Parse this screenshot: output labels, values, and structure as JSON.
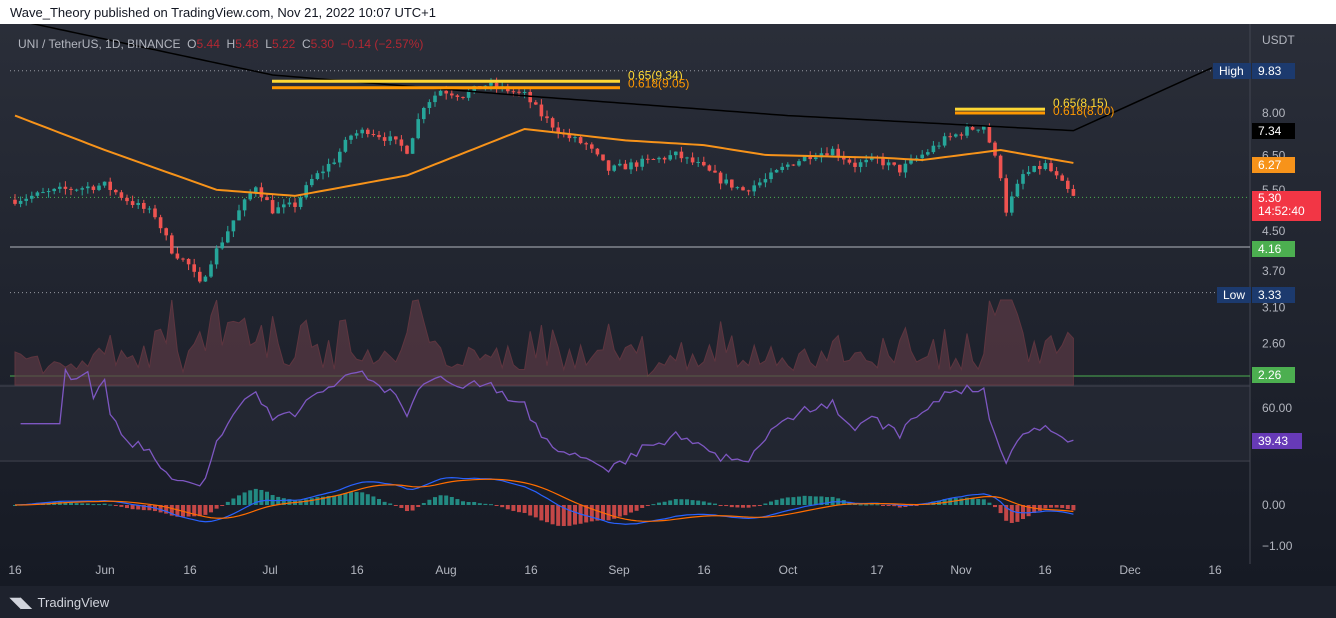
{
  "header": {
    "publisher": "Wave_Theory published on TradingView.com, Nov 21, 2022 10:07 UTC+1"
  },
  "legend": {
    "symbol": "UNI / TetherUS, 1D, BINANCE",
    "o_label": "O",
    "o": "5.44",
    "h_label": "H",
    "h": "5.48",
    "l_label": "L",
    "l": "5.22",
    "c_label": "C",
    "c": "5.30",
    "change": "−0.14 (−2.57%)"
  },
  "price_axis": {
    "currency": "USDT",
    "ticks": [
      "8.00",
      "6.50",
      "5.50",
      "4.50",
      "3.70",
      "3.10",
      "2.60"
    ]
  },
  "tags": {
    "high_label": "High",
    "high": "9.83",
    "ma200": "7.34",
    "ma50": "6.27",
    "last": "5.30",
    "countdown": "14:52:40",
    "support": "4.16",
    "low_label": "Low",
    "low": "3.33",
    "volume": "2.26",
    "rsi": "39.43"
  },
  "fib": {
    "a1": "0.65(9.34)",
    "a2": "0.618(9.05)",
    "b1": "0.65(8.15)",
    "b2": "0.618(8.00)"
  },
  "rsi_axis": {
    "ticks": [
      "60.00"
    ]
  },
  "macd_axis": {
    "ticks": [
      "0.00",
      "−1.00"
    ]
  },
  "time_axis": {
    "ticks": [
      "16",
      "Jun",
      "16",
      "Jul",
      "16",
      "Aug",
      "16",
      "Sep",
      "16",
      "Oct",
      "17",
      "Nov",
      "16",
      "Dec",
      "16"
    ]
  },
  "footer": {
    "brand": "TradingView"
  },
  "colors": {
    "up": "#26a69a",
    "down": "#ef5350",
    "ma50": "#f7931a",
    "ma200": "#000000",
    "rsi": "#7e57c2",
    "fib1": "#fdd835",
    "fib2": "#ff9800"
  },
  "chart_data": {
    "type": "candlestick",
    "title": "UNI / TetherUS, 1D, BINANCE",
    "scale": "log",
    "ylim": [
      2.3,
      11
    ],
    "close_anchors": [
      [
        "2022-05-16",
        5.24
      ],
      [
        "2022-05-24",
        5.49
      ],
      [
        "2022-06-01",
        5.63
      ],
      [
        "2022-06-05",
        5.24
      ],
      [
        "2022-06-10",
        4.86
      ],
      [
        "2022-06-13",
        4.1
      ],
      [
        "2022-06-16",
        3.81
      ],
      [
        "2022-06-18",
        3.46
      ],
      [
        "2022-06-20",
        3.9
      ],
      [
        "2022-06-24",
        4.74
      ],
      [
        "2022-06-28",
        5.63
      ],
      [
        "2022-07-01",
        4.98
      ],
      [
        "2022-07-05",
        5.11
      ],
      [
        "2022-07-08",
        5.77
      ],
      [
        "2022-07-12",
        6.36
      ],
      [
        "2022-07-15",
        7.18
      ],
      [
        "2022-07-18",
        7.36
      ],
      [
        "2022-07-22",
        7.02
      ],
      [
        "2022-07-25",
        6.68
      ],
      [
        "2022-07-28",
        8.32
      ],
      [
        "2022-07-31",
        8.95
      ],
      [
        "2022-08-04",
        8.73
      ],
      [
        "2022-08-08",
        9.17
      ],
      [
        "2022-08-12",
        8.95
      ],
      [
        "2022-08-15",
        8.73
      ],
      [
        "2022-08-18",
        7.92
      ],
      [
        "2022-08-22",
        7.18
      ],
      [
        "2022-08-26",
        6.84
      ],
      [
        "2022-08-30",
        6.06
      ],
      [
        "2022-09-03",
        6.21
      ],
      [
        "2022-09-07",
        6.36
      ],
      [
        "2022-09-11",
        6.52
      ],
      [
        "2022-09-15",
        6.21
      ],
      [
        "2022-09-19",
        5.77
      ],
      [
        "2022-09-23",
        5.49
      ],
      [
        "2022-09-27",
        5.77
      ],
      [
        "2022-10-01",
        6.21
      ],
      [
        "2022-10-05",
        6.52
      ],
      [
        "2022-10-09",
        6.68
      ],
      [
        "2022-10-13",
        6.21
      ],
      [
        "2022-10-17",
        6.36
      ],
      [
        "2022-10-21",
        6.06
      ],
      [
        "2022-10-25",
        6.52
      ],
      [
        "2022-10-29",
        7.02
      ],
      [
        "2022-11-02",
        7.36
      ],
      [
        "2022-11-05",
        7.54
      ],
      [
        "2022-11-08",
        5.91
      ],
      [
        "2022-11-09",
        4.98
      ],
      [
        "2022-11-12",
        5.91
      ],
      [
        "2022-11-16",
        6.21
      ],
      [
        "2022-11-21",
        5.3
      ]
    ],
    "ma50_anchors": [
      [
        "2022-05-16",
        7.9
      ],
      [
        "2022-06-01",
        6.68
      ],
      [
        "2022-06-21",
        5.5
      ],
      [
        "2022-07-05",
        5.34
      ],
      [
        "2022-07-25",
        5.9
      ],
      [
        "2022-08-15",
        7.4
      ],
      [
        "2022-09-02",
        7.0
      ],
      [
        "2022-09-16",
        6.84
      ],
      [
        "2022-09-27",
        6.52
      ],
      [
        "2022-10-18",
        6.43
      ],
      [
        "2022-10-25",
        6.36
      ],
      [
        "2022-11-08",
        6.68
      ],
      [
        "2022-11-21",
        6.27
      ]
    ],
    "ma200_anchors": [
      [
        "2022-05-16",
        12.6
      ],
      [
        "2022-07-01",
        9.63
      ],
      [
        "2022-08-15",
        8.7
      ],
      [
        "2022-10-01",
        7.9
      ],
      [
        "2022-11-21",
        7.34
      ]
    ],
    "levels": {
      "high": 9.83,
      "low": 3.33,
      "support": 4.16,
      "last": 5.3
    },
    "rsi_last": 39.43,
    "rsi_ylim": [
      20,
      80
    ],
    "macd_ylim": [
      -1.2,
      0.8
    ]
  }
}
